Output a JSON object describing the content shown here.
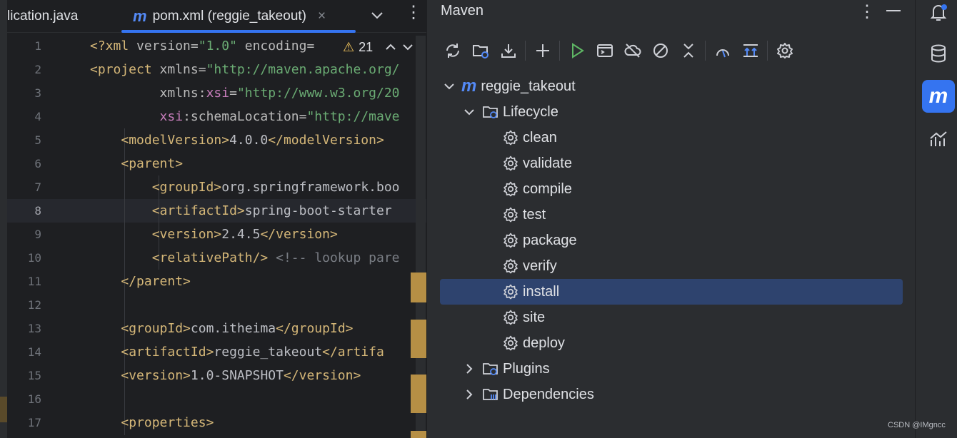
{
  "editor": {
    "tabs": [
      {
        "label": "lication.java"
      },
      {
        "label": "pom.xml (reggie_takeout)",
        "icon": "maven-m-icon"
      }
    ],
    "tab_close": "×",
    "inspection_count": "21",
    "line_numbers": [
      "1",
      "2",
      "3",
      "4",
      "5",
      "6",
      "7",
      "8",
      "9",
      "10",
      "11",
      "12",
      "13",
      "14",
      "15",
      "16",
      "17"
    ],
    "current_line": "8"
  },
  "maven": {
    "title": "Maven",
    "project": "reggie_takeout",
    "lifecycle_label": "Lifecycle",
    "phases": [
      "clean",
      "validate",
      "compile",
      "test",
      "package",
      "verify",
      "install",
      "site",
      "deploy"
    ],
    "selected_phase": "install",
    "plugins_label": "Plugins",
    "dependencies_label": "Dependencies"
  },
  "colors": {
    "accent": "#3574f0",
    "selection": "#2e436e",
    "xml_tag": "#d5b778",
    "xml_value": "#6aab73",
    "xml_namespace": "#c77dbb",
    "warning": "#f2c55c"
  },
  "watermark": "CSDN @IMgncc"
}
